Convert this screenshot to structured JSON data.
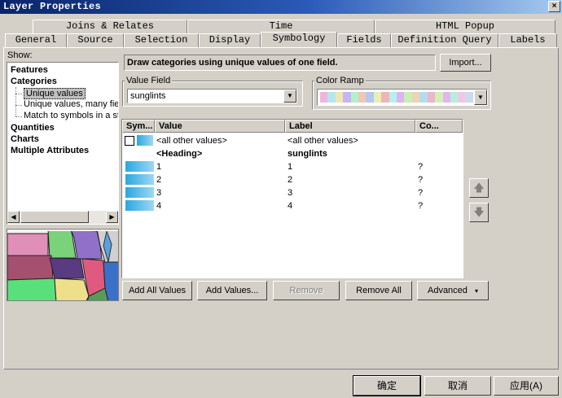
{
  "window": {
    "title": "Layer Properties",
    "close_glyph": "×"
  },
  "tabs": {
    "row1": [
      "Joins & Relates",
      "Time",
      "HTML Popup"
    ],
    "row2": [
      "General",
      "Source",
      "Selection",
      "Display",
      "Symbology",
      "Fields",
      "Definition Query",
      "Labels"
    ],
    "active": "Symbology"
  },
  "show": {
    "label": "Show:",
    "items": [
      {
        "label": "Features",
        "bold": true
      },
      {
        "label": "Categories",
        "bold": true
      },
      {
        "label": "Unique values",
        "bold": false,
        "selected": true
      },
      {
        "label": "Unique values, many fiel",
        "bold": false
      },
      {
        "label": "Match to symbols in a sty",
        "bold": false
      },
      {
        "label": "Quantities",
        "bold": true
      },
      {
        "label": "Charts",
        "bold": true
      },
      {
        "label": "Multiple Attributes",
        "bold": true
      }
    ]
  },
  "description": "Draw categories using unique values of one field.",
  "import_label": "Import...",
  "value_field": {
    "label": "Value Field",
    "value": "sunglints"
  },
  "color_ramp": {
    "label": "Color Ramp",
    "colors": [
      "#f0b4dc",
      "#b4e6f0",
      "#f0e6b4",
      "#c8b4f0",
      "#b4f0c8",
      "#f0c8b4",
      "#b4c8f0",
      "#e6f0b4",
      "#f0b4b4",
      "#b4f0f0",
      "#dcb4f0",
      "#c8f0b4",
      "#f0d2b4",
      "#b4dcf0",
      "#f0b4c8",
      "#d2f0b4",
      "#e6b4f0",
      "#b4f0dc",
      "#f0c8e6",
      "#c8dcf0"
    ]
  },
  "grid": {
    "columns": [
      "Sym...",
      "Value",
      "Label",
      "Co..."
    ],
    "rows": [
      {
        "type": "other",
        "value": "<all other values>",
        "label": "<all other values>",
        "count": ""
      },
      {
        "type": "heading",
        "value": "<Heading>",
        "label": "sunglints",
        "count": ""
      },
      {
        "type": "item",
        "value": "1",
        "label": "1",
        "count": "?"
      },
      {
        "type": "item",
        "value": "2",
        "label": "2",
        "count": "?"
      },
      {
        "type": "item",
        "value": "3",
        "label": "3",
        "count": "?"
      },
      {
        "type": "item",
        "value": "4",
        "label": "4",
        "count": "?"
      }
    ]
  },
  "buttons": {
    "add_all": "Add All Values",
    "add_values": "Add Values...",
    "remove": "Remove",
    "remove_all": "Remove All",
    "advanced": "Advanced",
    "up_arrow": "🡅",
    "down_arrow": "🡇"
  },
  "footer": {
    "ok": "确定",
    "cancel": "取消",
    "apply": "应用(A)"
  }
}
